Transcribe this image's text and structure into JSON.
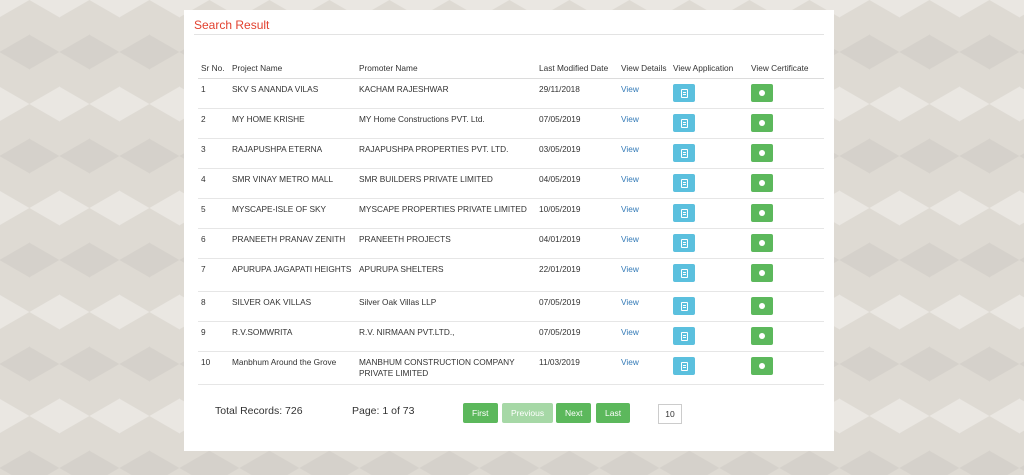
{
  "panel": {
    "title": "Search Result"
  },
  "table": {
    "headers": {
      "sr": "Sr No.",
      "project": "Project Name",
      "promoter": "Promoter Name",
      "modified": "Last Modified Date",
      "details": "View Details",
      "application": "View Application",
      "certificate": "View Certificate"
    },
    "rows": [
      {
        "sr": "1",
        "project": "SKV S ANANDA VILAS",
        "promoter": "KACHAM RAJESHWAR",
        "modified": "29/11/2018",
        "view": "View"
      },
      {
        "sr": "2",
        "project": "MY HOME KRISHE",
        "promoter": "MY Home Constructions PVT. Ltd.",
        "modified": "07/05/2019",
        "view": "View"
      },
      {
        "sr": "3",
        "project": "RAJAPUSHPA ETERNA",
        "promoter": "RAJAPUSHPA PROPERTIES PVT. LTD.",
        "modified": "03/05/2019",
        "view": "View"
      },
      {
        "sr": "4",
        "project": "SMR VINAY METRO MALL",
        "promoter": "SMR BUILDERS PRIVATE LIMITED",
        "modified": "04/05/2019",
        "view": "View"
      },
      {
        "sr": "5",
        "project": "MYSCAPE-ISLE OF SKY",
        "promoter": "MYSCAPE PROPERTIES PRIVATE LIMITED",
        "modified": "10/05/2019",
        "view": "View"
      },
      {
        "sr": "6",
        "project": "PRANEETH PRANAV ZENITH",
        "promoter": "PRANEETH PROJECTS",
        "modified": "04/01/2019",
        "view": "View"
      },
      {
        "sr": "7",
        "project": "APURUPA JAGAPATI HEIGHTS",
        "promoter": "APURUPA SHELTERS",
        "modified": "22/01/2019",
        "view": "View"
      },
      {
        "sr": "8",
        "project": "SILVER OAK VILLAS",
        "promoter": "Silver Oak Villas LLP",
        "modified": "07/05/2019",
        "view": "View"
      },
      {
        "sr": "9",
        "project": "R.V.SOMWRITA",
        "promoter": "R.V. NIRMAAN PVT.LTD.,",
        "modified": "07/05/2019",
        "view": "View"
      },
      {
        "sr": "10",
        "project": "Manbhum Around the Grove",
        "promoter": "MANBHUM CONSTRUCTION COMPANY PRIVATE LIMITED",
        "modified": "11/03/2019",
        "view": "View"
      }
    ]
  },
  "footer": {
    "total_records": "Total Records: 726",
    "page_info": "Page: 1 of 73",
    "first": "First",
    "previous": "Previous",
    "next": "Next",
    "last": "Last",
    "page_size": "10"
  },
  "icons": {
    "application": "document-icon",
    "certificate": "certificate-icon"
  },
  "colors": {
    "title": "#e2412f",
    "link": "#337ab7",
    "application_button": "#5bc0de",
    "certificate_button": "#5cb85c",
    "pager_button": "#5cb85c",
    "pager_disabled": "#a6d8a6"
  }
}
